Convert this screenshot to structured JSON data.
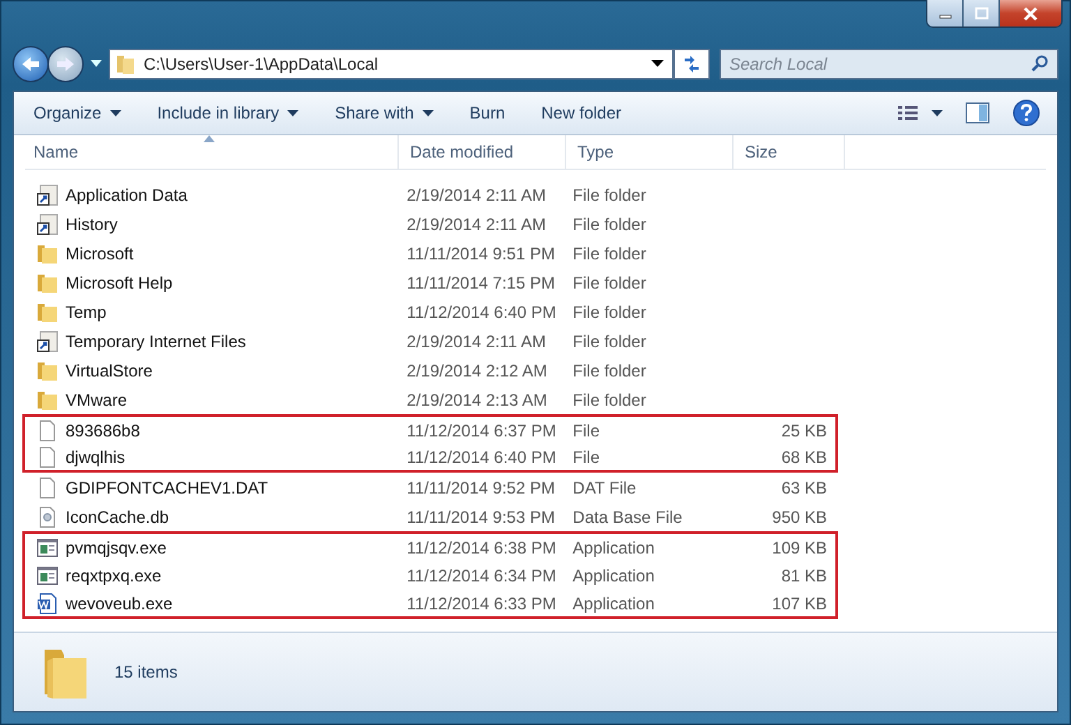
{
  "address": {
    "path": "C:\\Users\\User-1\\AppData\\Local"
  },
  "search": {
    "placeholder": "Search Local"
  },
  "toolbar": [
    {
      "label": "Organize",
      "dropdown": true
    },
    {
      "label": "Include in library",
      "dropdown": true
    },
    {
      "label": "Share with",
      "dropdown": true
    },
    {
      "label": "Burn",
      "dropdown": false
    },
    {
      "label": "New folder",
      "dropdown": false
    }
  ],
  "columns": [
    "Name",
    "Date modified",
    "Type",
    "Size"
  ],
  "rows": [
    {
      "name": "Application Data",
      "date": "2/19/2014 2:11 AM",
      "type": "File folder",
      "kind": "shortcut",
      "flagged": false
    },
    {
      "name": "History",
      "date": "2/19/2014 2:11 AM",
      "type": "File folder",
      "kind": "shortcut",
      "flagged": false
    },
    {
      "name": "Microsoft",
      "date": "11/11/2014 9:51 PM",
      "type": "File folder",
      "kind": "folder",
      "flagged": false
    },
    {
      "name": "Microsoft Help",
      "date": "11/11/2014 7:15 PM",
      "type": "File folder",
      "kind": "folder",
      "flagged": false
    },
    {
      "name": "Temp",
      "date": "11/12/2014 6:40 PM",
      "type": "File folder",
      "kind": "folder",
      "flagged": false
    },
    {
      "name": "Temporary Internet Files",
      "date": "2/19/2014 2:11 AM",
      "type": "File folder",
      "kind": "shortcut",
      "flagged": false
    },
    {
      "name": "VirtualStore",
      "date": "2/19/2014 2:12 AM",
      "type": "File folder",
      "kind": "folder",
      "flagged": false
    },
    {
      "name": "VMware",
      "date": "2/19/2014 2:13 AM",
      "type": "File folder",
      "kind": "folder",
      "flagged": false
    },
    {
      "name": "893686b8",
      "date": "11/12/2014 6:37 PM",
      "type": "File",
      "size": "25 KB",
      "kind": "file",
      "flagged": true
    },
    {
      "name": "djwqlhis",
      "date": "11/12/2014 6:40 PM",
      "type": "File",
      "size": "68 KB",
      "kind": "file",
      "flagged": true
    },
    {
      "name": "GDIPFONTCACHEV1.DAT",
      "date": "11/11/2014 9:52 PM",
      "type": "DAT File",
      "size": "63 KB",
      "kind": "file",
      "flagged": false
    },
    {
      "name": "IconCache.db",
      "date": "11/11/2014 9:53 PM",
      "type": "Data Base File",
      "size": "950 KB",
      "kind": "database",
      "flagged": false
    },
    {
      "name": "pvmqjsqv.exe",
      "date": "11/12/2014 6:38 PM",
      "type": "Application",
      "size": "109 KB",
      "kind": "application",
      "flagged": true
    },
    {
      "name": "reqxtpxq.exe",
      "date": "11/12/2014 6:34 PM",
      "type": "Application",
      "size": "81 KB",
      "kind": "application",
      "flagged": true
    },
    {
      "name": "wevoveub.exe",
      "date": "11/12/2014 6:33 PM",
      "type": "Application",
      "size": "107 KB",
      "kind": "document",
      "flagged": true
    }
  ],
  "status_bar": {
    "count": "15 items"
  }
}
